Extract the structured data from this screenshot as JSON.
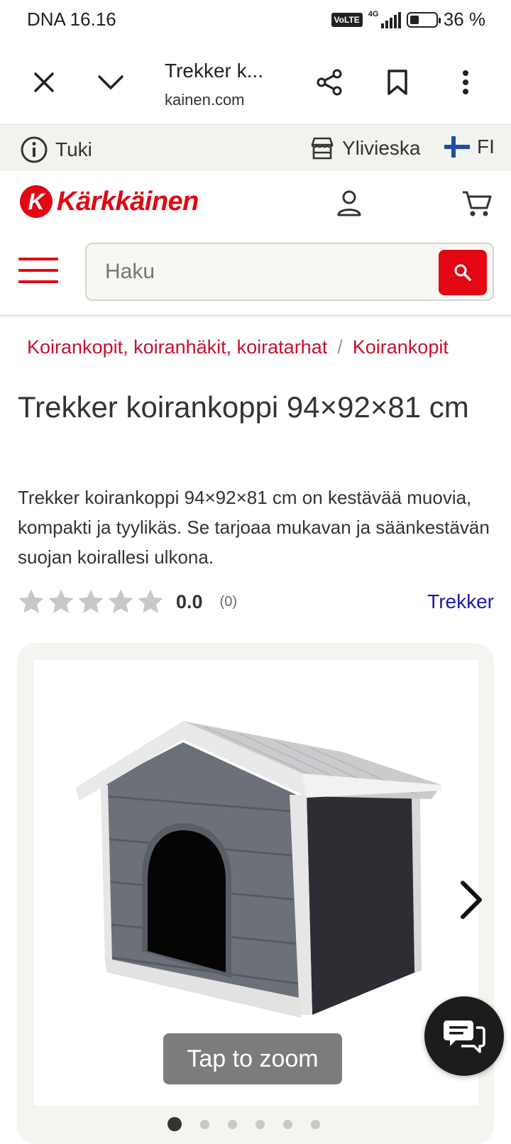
{
  "status_bar": {
    "carrier_time": "DNA 16.16",
    "volte": "VoLTE",
    "network": "4G",
    "battery_text": "36 %",
    "battery_level_percent": 36
  },
  "browser": {
    "title": "Trekker k...",
    "url": "kainen.com",
    "icons": [
      "close-icon",
      "chevron-down-icon",
      "share-icon",
      "bookmark-icon",
      "more-vert-icon"
    ]
  },
  "info_strip": {
    "support_label": "Tuki",
    "store_label": "Ylivieska",
    "language_label": "FI"
  },
  "header": {
    "logo_text": "Kärkkäinen",
    "logo_letter": "K",
    "search_placeholder": "Haku",
    "brand_color": "#e30613"
  },
  "breadcrumb": {
    "items": [
      "Koirankopit, koiranhäkit, koiratarhat",
      "Koirankopit"
    ],
    "separator": "/"
  },
  "product": {
    "title": "Trekker koirankoppi 94×92×81 cm",
    "description": "Trekker koirankoppi 94×92×81 cm on kestävää muovia, kompakti ja tyylikäs. Se tarjoaa mukavan ja säänkestävän suojan koirallesi ulkona.",
    "rating_value": "0.0",
    "rating_stars": 0,
    "rating_count": "(0)",
    "brand": "Trekker"
  },
  "gallery": {
    "zoom_label": "Tap to zoom",
    "image_count": 6,
    "active_index": 0
  }
}
